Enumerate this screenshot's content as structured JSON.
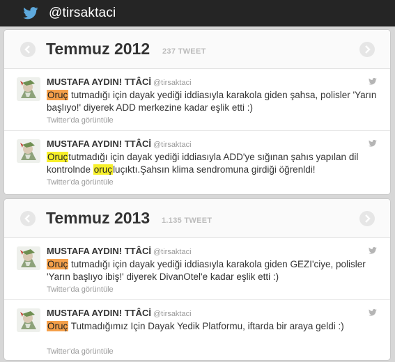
{
  "header": {
    "handle": "@tirsaktaci",
    "icon": "twitter-bird-icon"
  },
  "colors": {
    "topbar": "#252525",
    "highlight_orange": "#f5a04a",
    "highlight_yellow": "#f7f02a"
  },
  "months": [
    {
      "title": "Temmuz 2012",
      "count": "237 TWEET",
      "tweets": [
        {
          "name": "MUSTAFA AYDIN! TTÂCİ",
          "screen_name": "@tirsaktaci",
          "p1": "Oruç",
          "p2": " tutmadığı için dayak yediği iddiasıyla karakola giden şahsa, polisler 'Yarın başlıyo!' diyerek ADD merkezine kadar eşlik etti :)",
          "view": "Twitter'da görüntüle"
        },
        {
          "name": "MUSTAFA AYDIN! TTÂCİ",
          "screen_name": "@tirsaktaci",
          "p1": "Oruç",
          "p2": "tutmadığı için dayak yediği iddiasıyla ADD'ye sığınan şahıs yapılan dil kontrolnde ",
          "p3": "oruç",
          "p4": "luçıktı.Şahsın klima sendromuna girdiği öğrenldi!",
          "view": "Twitter'da görüntüle"
        }
      ]
    },
    {
      "title": "Temmuz 2013",
      "count": "1.135 TWEET",
      "tweets": [
        {
          "name": "MUSTAFA AYDIN! TTÂCİ",
          "screen_name": "@tirsaktaci",
          "p1": "Oruç",
          "p2": " tutmadığı için dayak yediği iddiasıyla karakola giden GEZI'ciye, polisler 'Yarın başlıyo ibiş!' diyerek DivanOtel'e kadar eşlik etti :)",
          "view": "Twitter'da görüntüle"
        },
        {
          "name": "MUSTAFA AYDIN! TTÂCİ",
          "screen_name": "@tirsaktaci",
          "p1": "Oruç",
          "p2": " Tutmadığımız Için Dayak Yedik Platformu, iftarda bir araya geldi :)",
          "view": "Twitter'da görüntüle"
        }
      ]
    }
  ]
}
